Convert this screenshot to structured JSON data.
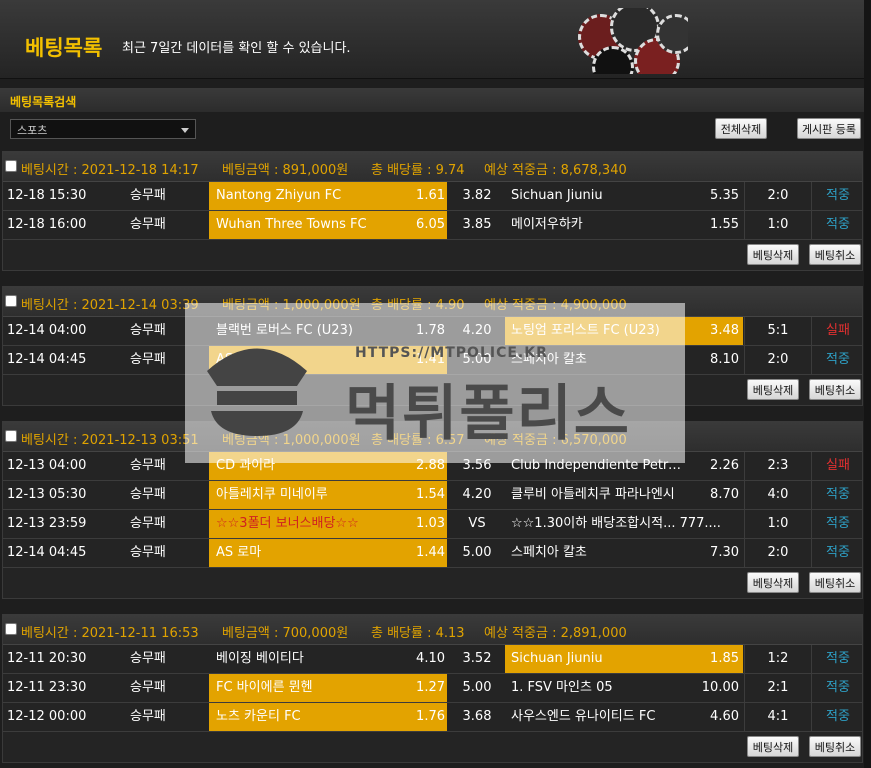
{
  "header": {
    "title": "베팅목록",
    "description": "최근 7일간 데이터를 확인 할 수 있습니다."
  },
  "search": {
    "title": "베팅목록검색",
    "select_value": "스포츠",
    "delete_all_label": "전체삭제",
    "board_post_label": "게시판 등록"
  },
  "labels": {
    "bet_delete": "베팅삭제",
    "bet_cancel": "베팅취소"
  },
  "watermark": {
    "url": "HTTPS://MTPOLICE.KR",
    "text": "먹튀폴리스"
  },
  "colors": {
    "accent": "#f3c000",
    "selected": "#e3a300",
    "win": "#2e9fc4",
    "lose": "#e03030"
  },
  "bets": [
    {
      "time": "베팅시간 : 2021-12-18 14:17",
      "amount": "베팅금액 : 891,000원",
      "odds": "총 배당률 : 9.74",
      "expected": "예상 적중금 : 8,678,340",
      "rows": [
        {
          "date": "12-18 15:30",
          "type": "승무패",
          "home": "Nantong Zhiyun FC",
          "home_odds": "1.61",
          "draw": "3.82",
          "away": "Sichuan Jiuniu",
          "away_odds": "5.35",
          "score": "2:0",
          "result": "적중",
          "pick": "home",
          "special": false
        },
        {
          "date": "12-18 16:00",
          "type": "승무패",
          "home": "Wuhan Three Towns FC",
          "home_odds": "6.05",
          "draw": "3.85",
          "away": "메이저우하카",
          "away_odds": "1.55",
          "score": "1:0",
          "result": "적중",
          "pick": "home",
          "special": false
        }
      ]
    },
    {
      "time": "베팅시간 : 2021-12-14 03:39",
      "amount": "베팅금액 : 1,000,000원",
      "odds": "총 배당률 : 4.90",
      "expected": "예상 적중금 : 4,900,000",
      "rows": [
        {
          "date": "12-14 04:00",
          "type": "승무패",
          "home": "블랙번 로버스 FC (U23)",
          "home_odds": "1.78",
          "draw": "4.20",
          "away": "노팅엄 포리스트 FC (U23)",
          "away_odds": "3.48",
          "score": "5:1",
          "result": "실패",
          "pick": "away",
          "special": false
        },
        {
          "date": "12-14 04:45",
          "type": "승무패",
          "home": "AS 로마",
          "home_odds": "1.41",
          "draw": "5.00",
          "away": "스페치아 칼초",
          "away_odds": "8.10",
          "score": "2:0",
          "result": "적중",
          "pick": "home",
          "special": false
        }
      ]
    },
    {
      "time": "베팅시간 : 2021-12-13 03:51",
      "amount": "베팅금액 : 1,000,000원",
      "odds": "총 배당률 : 6.57",
      "expected": "예상 적중금 : 6,570,000",
      "rows": [
        {
          "date": "12-13 04:00",
          "type": "승무패",
          "home": "CD 과이라",
          "home_odds": "2.88",
          "draw": "3.56",
          "away": "Club Independiente Petrol...",
          "away_odds": "2.26",
          "score": "2:3",
          "result": "실패",
          "pick": "home",
          "special": false
        },
        {
          "date": "12-13 05:30",
          "type": "승무패",
          "home": "아틀레치쿠 미네이루",
          "home_odds": "1.54",
          "draw": "4.20",
          "away": "클루비 아틀레치쿠 파라나엔시",
          "away_odds": "8.70",
          "score": "4:0",
          "result": "적중",
          "pick": "home",
          "special": false
        },
        {
          "date": "12-13 23:59",
          "type": "승무패",
          "home": "☆☆3폴더 보너스배당☆☆",
          "home_odds": "1.03",
          "draw": "VS",
          "away": "☆☆1.30이하 배당조합시적... 777....",
          "away_odds": "",
          "score": "1:0",
          "result": "적중",
          "pick": "home",
          "special": true
        },
        {
          "date": "12-14 04:45",
          "type": "승무패",
          "home": "AS 로마",
          "home_odds": "1.44",
          "draw": "5.00",
          "away": "스페치아 칼초",
          "away_odds": "7.30",
          "score": "2:0",
          "result": "적중",
          "pick": "home",
          "special": false
        }
      ]
    },
    {
      "time": "베팅시간 : 2021-12-11 16:53",
      "amount": "베팅금액 : 700,000원",
      "odds": "총 배당률 : 4.13",
      "expected": "예상 적중금 : 2,891,000",
      "rows": [
        {
          "date": "12-11 20:30",
          "type": "승무패",
          "home": "베이징 베이티다",
          "home_odds": "4.10",
          "draw": "3.52",
          "away": "Sichuan Jiuniu",
          "away_odds": "1.85",
          "score": "1:2",
          "result": "적중",
          "pick": "away",
          "special": false
        },
        {
          "date": "12-11 23:30",
          "type": "승무패",
          "home": "FC 바이에른 뮌헨",
          "home_odds": "1.27",
          "draw": "5.00",
          "away": "1. FSV 마인츠 05",
          "away_odds": "10.00",
          "score": "2:1",
          "result": "적중",
          "pick": "home",
          "special": false
        },
        {
          "date": "12-12 00:00",
          "type": "승무패",
          "home": "노츠 카운티 FC",
          "home_odds": "1.76",
          "draw": "3.68",
          "away": "사우스엔드 유나이티드 FC",
          "away_odds": "4.60",
          "score": "4:1",
          "result": "적중",
          "pick": "home",
          "special": false
        }
      ]
    }
  ]
}
